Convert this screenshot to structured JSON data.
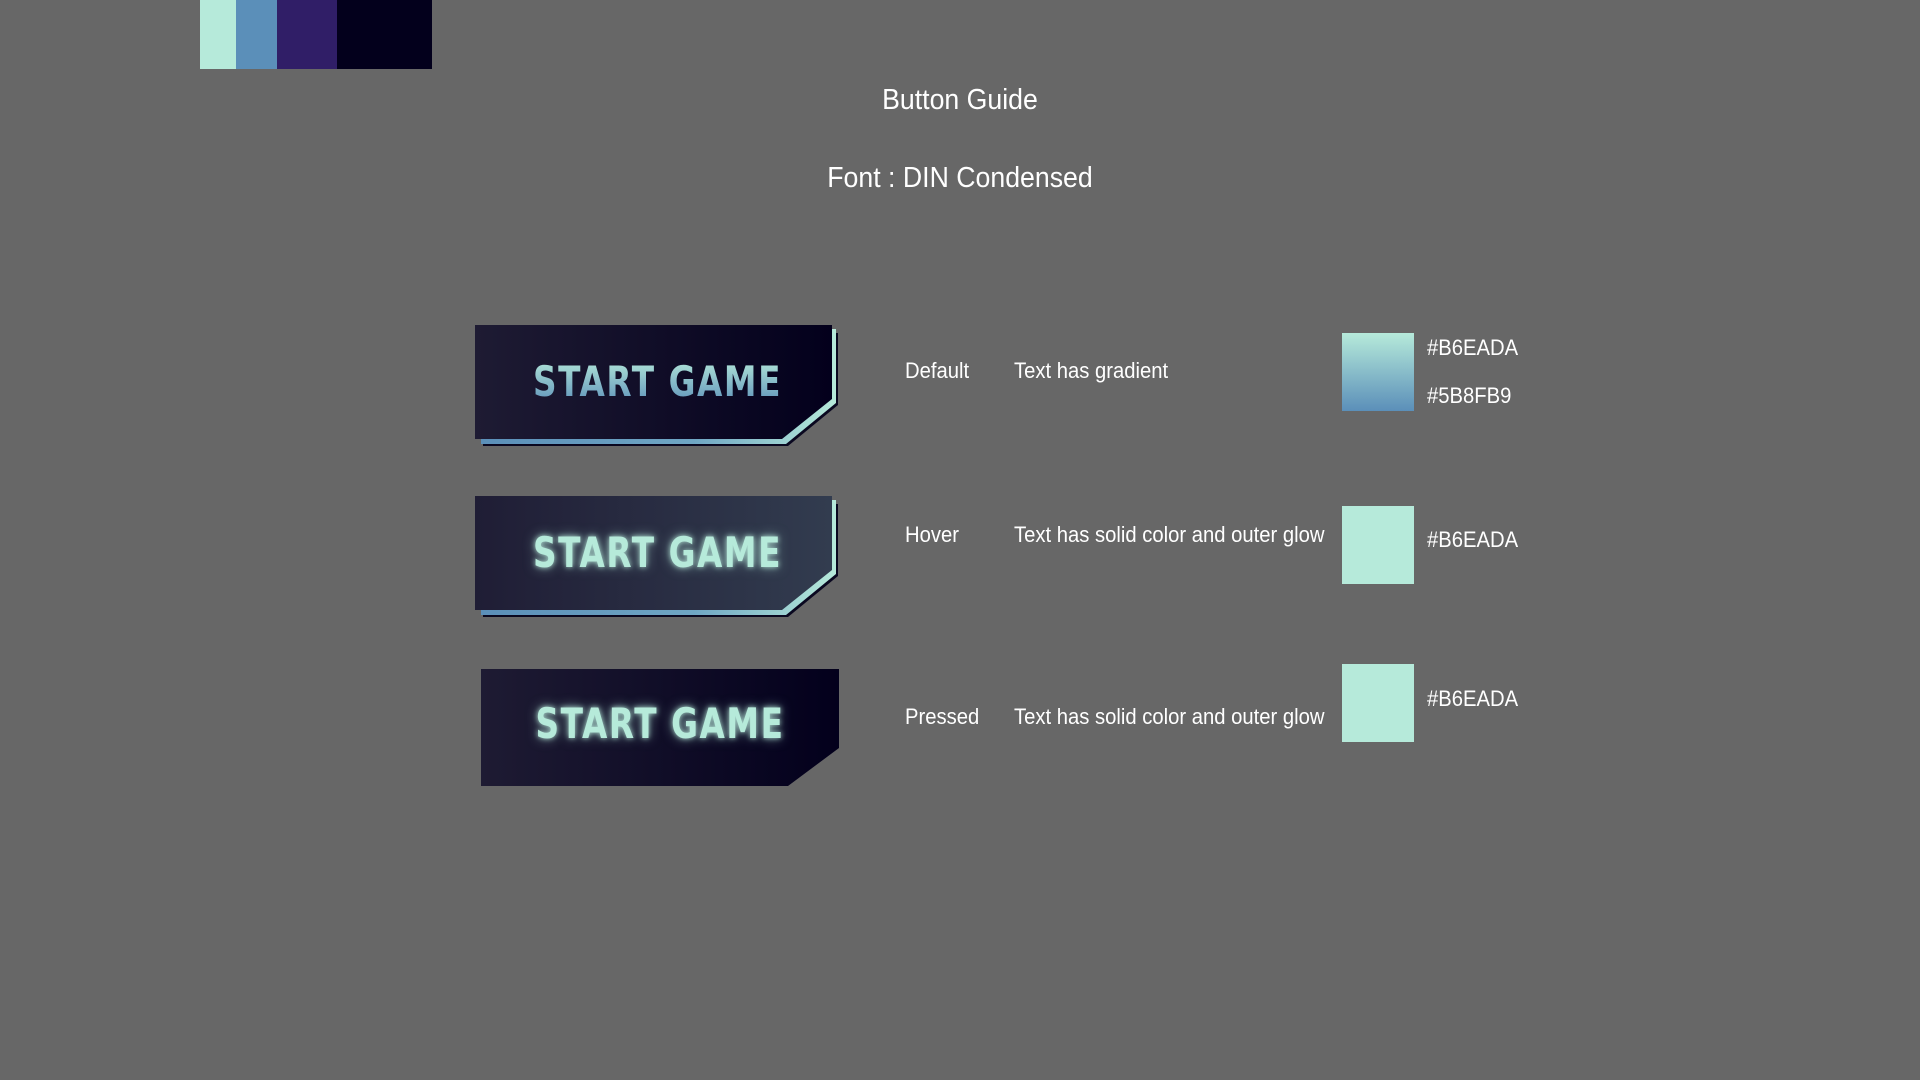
{
  "palette": [
    "#B6EADA",
    "#5B8FB9",
    "#301E67",
    "#03001C"
  ],
  "header": {
    "title": "Button Guide",
    "font_note": "Font : DIN Condensed"
  },
  "buttons": [
    {
      "label": "START GAME",
      "state": "Default",
      "description": "Text has gradient",
      "swatch_colors": [
        "#B6EADA",
        "#5B8FB9"
      ],
      "swatch_hexes": [
        "#B6EADA",
        "#5B8FB9"
      ]
    },
    {
      "label": "START GAME",
      "state": "Hover",
      "description": "Text has solid color and outer glow",
      "swatch_colors": [
        "#B6EADA"
      ],
      "swatch_hexes": [
        "#B6EADA"
      ]
    },
    {
      "label": "START GAME",
      "state": "Pressed",
      "description": "Text has solid color and outer glow",
      "swatch_colors": [
        "#B6EADA"
      ],
      "swatch_hexes": [
        "#B6EADA"
      ]
    }
  ]
}
